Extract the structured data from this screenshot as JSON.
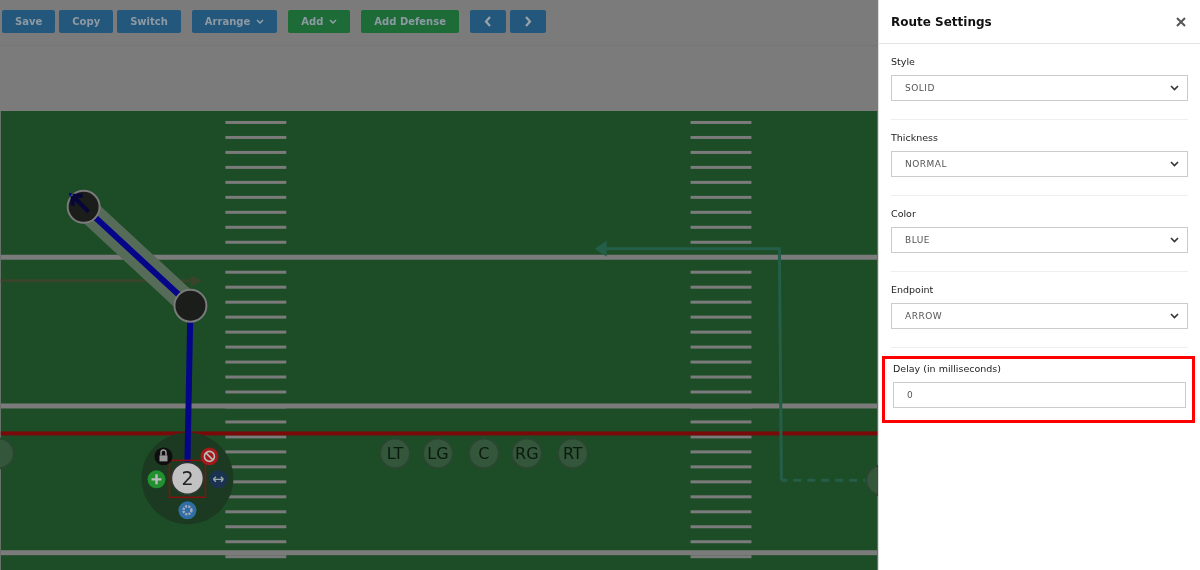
{
  "toolbar": [
    {
      "kind": "button",
      "label": "Save",
      "color": "#24577c"
    },
    {
      "kind": "button",
      "label": "Copy",
      "color": "#24577c"
    },
    {
      "kind": "button",
      "label": "Switch",
      "color": "#24577c"
    },
    {
      "kind": "dropdown",
      "label": "Arrange",
      "color": "#24577c"
    },
    {
      "kind": "dropdown",
      "label": "Add",
      "color": "#1d6b37"
    },
    {
      "kind": "button",
      "label": "Add Defense",
      "color": "#1d6b37"
    },
    {
      "kind": "prev",
      "color": "#24577c"
    },
    {
      "kind": "next",
      "color": "#24577c"
    }
  ],
  "players": [
    {
      "label": "LT",
      "selected": false
    },
    {
      "label": "LG",
      "selected": false
    },
    {
      "label": "C",
      "selected": false
    },
    {
      "label": "RG",
      "selected": false
    },
    {
      "label": "RT",
      "selected": false
    },
    {
      "label": "2",
      "selected": true
    }
  ],
  "panel": {
    "title": "Route Settings",
    "fields": [
      {
        "kind": "select",
        "label": "Style",
        "value": "SOLID",
        "highlighted": false
      },
      {
        "kind": "select",
        "label": "Thickness",
        "value": "NORMAL",
        "highlighted": false
      },
      {
        "kind": "select",
        "label": "Color",
        "value": "BLUE",
        "highlighted": false
      },
      {
        "kind": "select",
        "label": "Endpoint",
        "value": "ARROW",
        "highlighted": false
      },
      {
        "kind": "input",
        "label": "Delay (in milliseconds)",
        "value": "0",
        "highlighted": true
      }
    ]
  }
}
